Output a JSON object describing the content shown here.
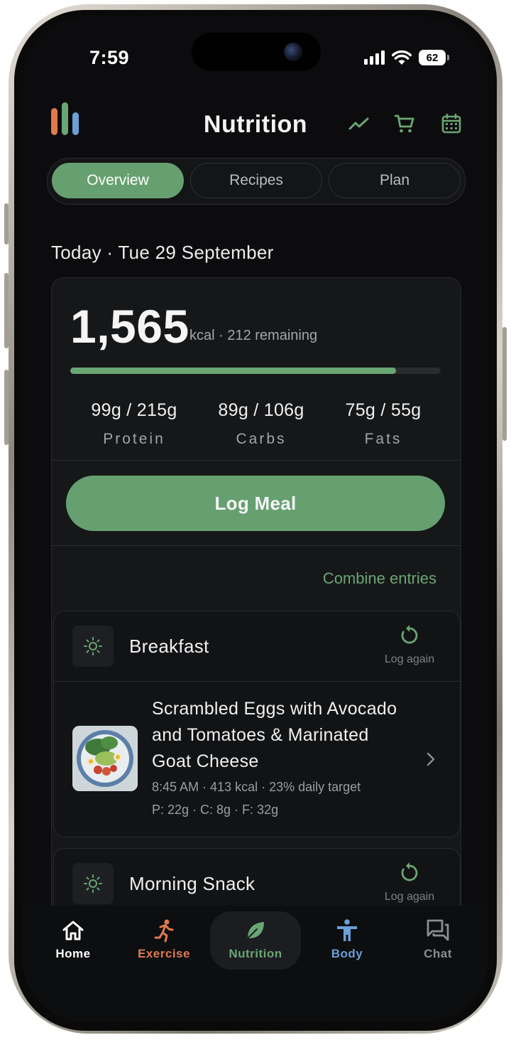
{
  "status_bar": {
    "time": "7:59",
    "battery": "62"
  },
  "header": {
    "title": "Nutrition",
    "icons": [
      "trend-icon",
      "cart-icon",
      "calendar-icon"
    ]
  },
  "tabs": [
    {
      "label": "Overview",
      "active": true
    },
    {
      "label": "Recipes",
      "active": false
    },
    {
      "label": "Plan",
      "active": false
    }
  ],
  "date_line": "Today · Tue 29 September",
  "summary": {
    "kcal": "1,565",
    "kcal_sub": "kcal · 212 remaining",
    "progress_fraction": 0.88,
    "macros": [
      {
        "value": "99g / 215g",
        "label": "Protein"
      },
      {
        "value": "89g / 106g",
        "label": "Carbs"
      },
      {
        "value": "75g / 55g",
        "label": "Fats"
      }
    ],
    "log_meal_label": "Log Meal",
    "combine_label": "Combine entries"
  },
  "meals": [
    {
      "title": "Breakfast",
      "log_again": "Log again",
      "entries": [
        {
          "name": "Scrambled Eggs with Avocado and Tomatoes & Marinated Goat Cheese",
          "meta": "8:45 AM · 413 kcal · 23% daily target",
          "macros": "P: 22g · C: 8g · F: 32g"
        }
      ]
    },
    {
      "title": "Morning Snack",
      "log_again": "Log again"
    }
  ],
  "bottom_nav": [
    {
      "label": "Home",
      "icon": "home-icon",
      "color": "#ffffff"
    },
    {
      "label": "Exercise",
      "icon": "running-icon",
      "color": "#e07a4e"
    },
    {
      "label": "Nutrition",
      "icon": "leaf-icon",
      "color": "#6aa673",
      "active": true
    },
    {
      "label": "Body",
      "icon": "person-icon",
      "color": "#6b9fd8"
    },
    {
      "label": "Chat",
      "icon": "chat-icon",
      "color": "#8a8d92"
    }
  ],
  "colors": {
    "accent": "#67a070",
    "background": "#0c0c0e",
    "card": "#161719"
  }
}
